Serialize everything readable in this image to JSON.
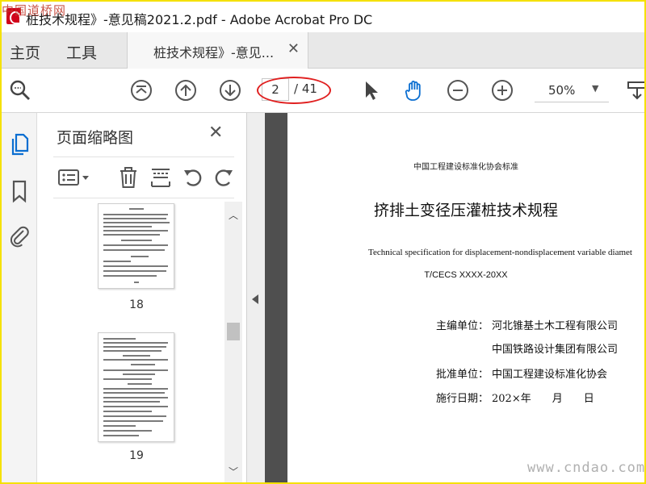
{
  "watermark": {
    "top": "中国道桥网",
    "bottom": "www.cndao.com"
  },
  "window": {
    "title": "桩技术规程》-意见稿2021.2.pdf - Adobe Acrobat Pro DC"
  },
  "tabs": {
    "home": "主页",
    "tools": "工具",
    "document": "桩技术规程》-意见..."
  },
  "toolbar": {
    "page_current": "2",
    "page_total": "/ 41",
    "zoom": "50%",
    "icons": [
      "search-zoom-icon",
      "first-page-icon",
      "prev-page-icon",
      "next-page-icon",
      "select-arrow-icon",
      "hand-tool-icon",
      "zoom-out-icon",
      "zoom-in-icon",
      "zoom-dropdown-icon",
      "scroll-mode-icon"
    ]
  },
  "left_rail": {
    "icons": [
      "pages-icon",
      "bookmark-icon",
      "attachment-icon"
    ]
  },
  "thumbnail_panel": {
    "title": "页面缩略图",
    "tool_icons": [
      "options-icon",
      "delete-icon",
      "extract-icon",
      "rotate-ccw-icon",
      "rotate-cw-icon"
    ],
    "thumbnails": [
      {
        "label": "18"
      },
      {
        "label": "19"
      }
    ]
  },
  "document": {
    "association": "中国工程建设标准化协会标准",
    "title": "挤排土变径压灌桩技术规程",
    "english_title": "Technical specification for displacement-nondisplacement variable diamet",
    "code": "T/CECS XXXX-20XX",
    "editor_label": "主编单位：",
    "editor_1": "河北锥基土木工程有限公司",
    "editor_2": "中国铁路设计集团有限公司",
    "approver_label": "批准单位：",
    "approver": "中国工程建设标准化协会",
    "date_label": "施行日期：",
    "date_value": "202×年　　月　　日"
  },
  "colors": {
    "frame": "#f5e100",
    "highlight": "#e02020",
    "accent": "#0a6ed1"
  }
}
